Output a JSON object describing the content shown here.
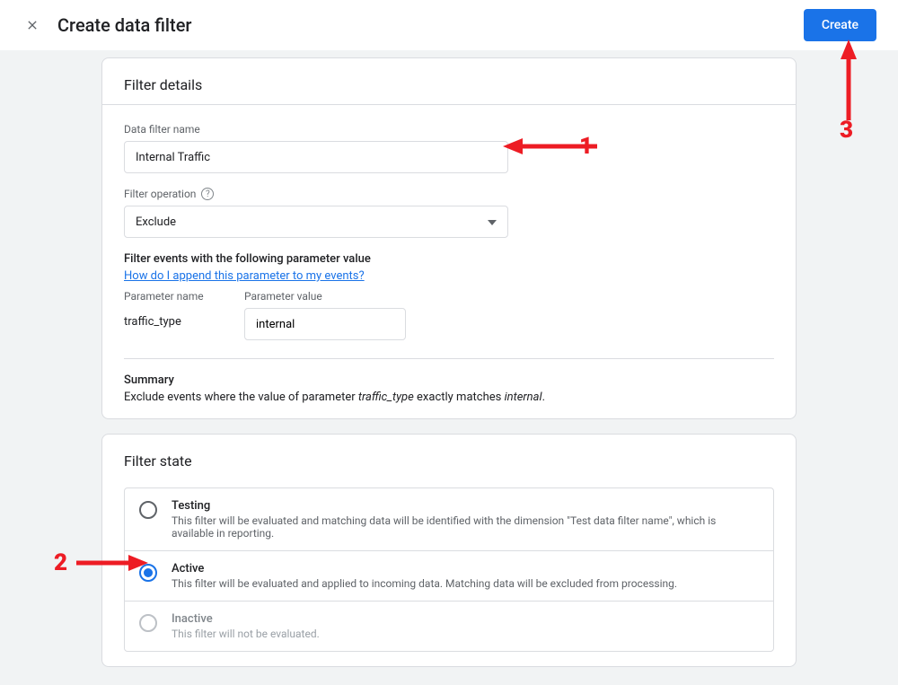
{
  "header": {
    "title": "Create data filter",
    "create_button": "Create"
  },
  "details": {
    "card_title": "Filter details",
    "name_label": "Data filter name",
    "name_value": "Internal Traffic",
    "operation_label": "Filter operation",
    "operation_value": "Exclude",
    "param_section_title": "Filter events with the following parameter value",
    "param_help_link": "How do I append this parameter to my events?",
    "param_name_label": "Parameter name",
    "param_name_value": "traffic_type",
    "param_value_label": "Parameter value",
    "param_value_value": "internal",
    "summary_title": "Summary",
    "summary_pre": "Exclude events where the value of parameter ",
    "summary_param": "traffic_type",
    "summary_mid": " exactly matches ",
    "summary_val": "internal",
    "summary_post": "."
  },
  "state": {
    "card_title": "Filter state",
    "options": [
      {
        "title": "Testing",
        "desc": "This filter will be evaluated and matching data will be identified with the dimension \"Test data filter name\", which is available in reporting.",
        "selected": false,
        "disabled": false
      },
      {
        "title": "Active",
        "desc": "This filter will be evaluated and applied to incoming data. Matching data will be excluded from processing.",
        "selected": true,
        "disabled": false
      },
      {
        "title": "Inactive",
        "desc": "This filter will not be evaluated.",
        "selected": false,
        "disabled": true
      }
    ]
  },
  "annotations": {
    "a1": "1",
    "a2": "2",
    "a3": "3"
  }
}
